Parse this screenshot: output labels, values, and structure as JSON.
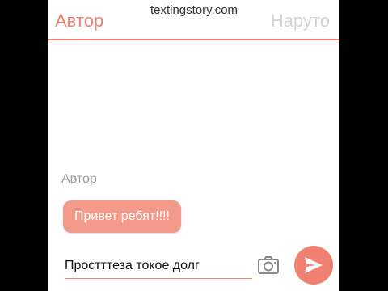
{
  "header": {
    "left_tab": "Автор",
    "right_tab": "Наруто"
  },
  "watermark": "textingstory.com",
  "conversation": {
    "messages": [
      {
        "sender": "Автор",
        "text": "Привет ребят!!!!"
      }
    ]
  },
  "composer": {
    "input_value": "Простттеза токое долг",
    "camera_icon": "camera-icon",
    "send_icon": "send-icon"
  },
  "colors": {
    "accent": "#f08070",
    "bubble": "#f39a8a",
    "inactive_tab": "#d4d4d4",
    "background": "#ffffff"
  }
}
